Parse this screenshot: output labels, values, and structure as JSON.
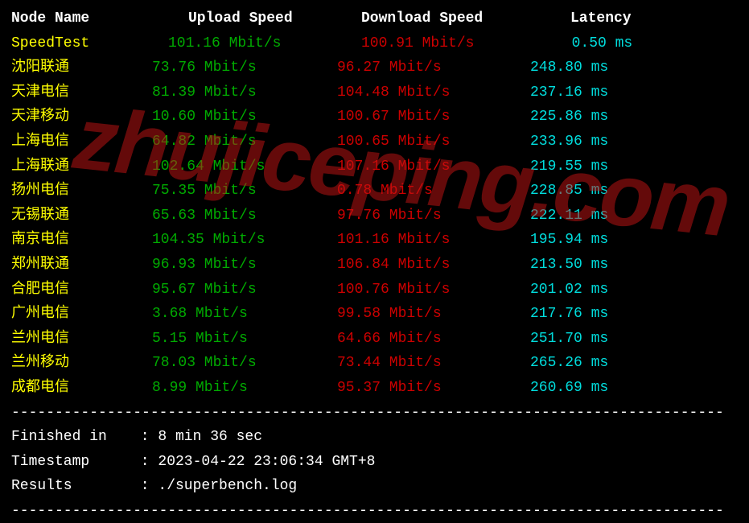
{
  "headers": {
    "node": "Node Name",
    "upload": "Upload Speed",
    "download": "Download Speed",
    "latency": "Latency"
  },
  "speedtest_row": {
    "node": "SpeedTest",
    "upload": "101.16 Mbit/s",
    "download": "100.91 Mbit/s",
    "latency": "0.50 ms"
  },
  "rows": [
    {
      "node": "沈阳联通",
      "upload": "73.76 Mbit/s",
      "download": "96.27 Mbit/s",
      "latency": "248.80 ms"
    },
    {
      "node": "天津电信",
      "upload": "81.39 Mbit/s",
      "download": "104.48 Mbit/s",
      "latency": "237.16 ms"
    },
    {
      "node": "天津移动",
      "upload": "10.60 Mbit/s",
      "download": "100.67 Mbit/s",
      "latency": "225.86 ms"
    },
    {
      "node": "上海电信",
      "upload": "64.82 Mbit/s",
      "download": "100.65 Mbit/s",
      "latency": "233.96 ms"
    },
    {
      "node": "上海联通",
      "upload": "102.64 Mbit/s",
      "download": "107.16 Mbit/s",
      "latency": "219.55 ms"
    },
    {
      "node": "扬州电信",
      "upload": "75.35 Mbit/s",
      "download": "0.78 Mbit/s",
      "latency": "228.85 ms"
    },
    {
      "node": "无锡联通",
      "upload": "65.63 Mbit/s",
      "download": "97.76 Mbit/s",
      "latency": "222.11 ms"
    },
    {
      "node": "南京电信",
      "upload": "104.35 Mbit/s",
      "download": "101.16 Mbit/s",
      "latency": "195.94 ms"
    },
    {
      "node": "郑州联通",
      "upload": "96.93 Mbit/s",
      "download": "106.84 Mbit/s",
      "latency": "213.50 ms"
    },
    {
      "node": "合肥电信",
      "upload": "95.67 Mbit/s",
      "download": "100.76 Mbit/s",
      "latency": "201.02 ms"
    },
    {
      "node": "广州电信",
      "upload": "3.68 Mbit/s",
      "download": "99.58 Mbit/s",
      "latency": "217.76 ms"
    },
    {
      "node": "兰州电信",
      "upload": "5.15 Mbit/s",
      "download": "64.66 Mbit/s",
      "latency": "251.70 ms"
    },
    {
      "node": "兰州移动",
      "upload": "78.03 Mbit/s",
      "download": "73.44 Mbit/s",
      "latency": "265.26 ms"
    },
    {
      "node": "成都电信",
      "upload": "8.99 Mbit/s",
      "download": "95.37 Mbit/s",
      "latency": "260.69 ms"
    }
  ],
  "divider": "----------------------------------------------------------------------------------",
  "footer": {
    "finished_label": "Finished in",
    "finished_value": "8 min 36 sec",
    "timestamp_label": "Timestamp",
    "timestamp_value": "2023-04-22 23:06:34 GMT+8",
    "results_label": "Results",
    "results_value": "./superbench.log"
  },
  "watermark": "zhujiceping.com"
}
